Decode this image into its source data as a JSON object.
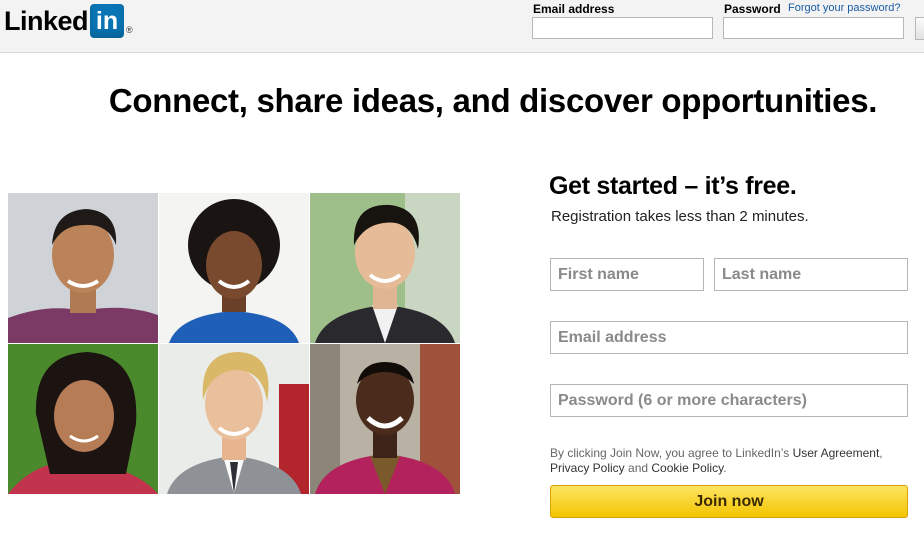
{
  "header": {
    "logo_text": "Linked",
    "logo_in": "in",
    "logo_reg": "®",
    "email_label": "Email address",
    "password_label": "Password",
    "forgot_link": "Forgot your password?"
  },
  "headline": "Connect, share ideas, and discover opportunities.",
  "registration": {
    "title": "Get started – it’s free.",
    "subtitle": "Registration takes less than 2 minutes.",
    "first_name_placeholder": "First name",
    "last_name_placeholder": "Last name",
    "email_placeholder": "Email address",
    "password_placeholder": "Password (6 or more characters)",
    "legal_prefix": "By clicking Join Now, you agree to LinkedIn’s ",
    "user_agreement": "User Agreement",
    "comma": ",",
    "privacy_policy": "Privacy Policy",
    "and": " and ",
    "cookie_policy": "Cookie Policy",
    "period": ".",
    "join_button": "Join now"
  },
  "colors": {
    "brand_blue": "#0a75b5",
    "link_blue": "#1a5da6",
    "join_yellow": "#f4c400"
  }
}
